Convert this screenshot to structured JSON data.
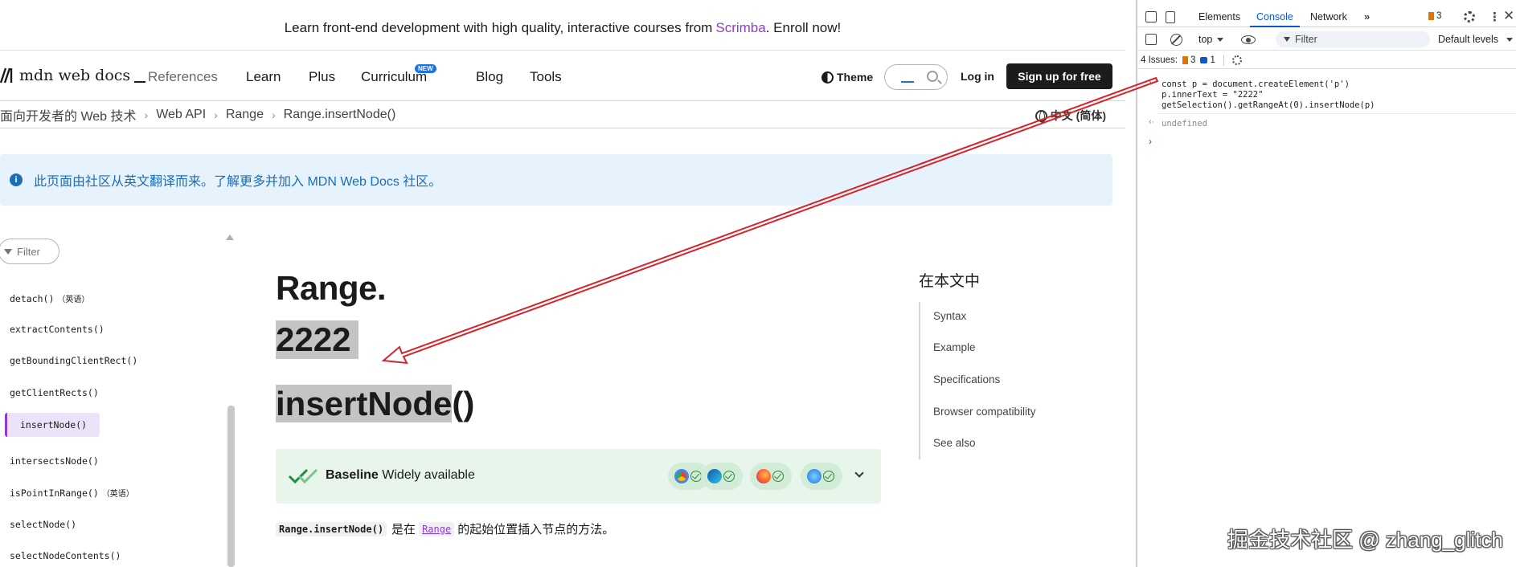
{
  "banner": {
    "prefix": "Learn front-end development with high quality, interactive courses from",
    "link": "Scrimba",
    "suffix": ". Enroll now!"
  },
  "nav": {
    "logo": "mdn web docs",
    "items": [
      "References",
      "Learn",
      "Plus",
      "Curriculum",
      "Blog",
      "Tools"
    ],
    "new_badge": "NEW",
    "theme": "Theme",
    "login": "Log in",
    "signup": "Sign up for free"
  },
  "breadcrumbs": {
    "items": [
      "面向开发者的 Web 技术",
      "Web API",
      "Range",
      "Range.insertNode()"
    ],
    "separator": "›",
    "language": "中文 (简体)"
  },
  "notice": {
    "icon": "i",
    "text": "此页面由社区从英文翻译而来。了解更多并加入 MDN Web Docs 社区。"
  },
  "sidebar": {
    "filter": "Filter",
    "items": [
      {
        "label": "detach()",
        "note": "（英语）"
      },
      {
        "label": "extractContents()",
        "note": ""
      },
      {
        "label": "getBoundingClientRect()",
        "note": ""
      },
      {
        "label": "getClientRects()",
        "note": ""
      },
      {
        "label": "insertNode()",
        "note": "",
        "active": true
      },
      {
        "label": "intersectsNode()",
        "note": ""
      },
      {
        "label": "isPointInRange()",
        "note": "（英语）"
      },
      {
        "label": "selectNode()",
        "note": ""
      },
      {
        "label": "selectNodeContents()",
        "note": ""
      }
    ]
  },
  "article": {
    "title_part1": "Range.",
    "inserted_text": "2222",
    "title_part2_hl": "insertNode",
    "title_part2_rest": "()",
    "baseline_label": "Baseline",
    "baseline_status": "Widely available",
    "desc_code": "Range.insertNode()",
    "desc_mid": "是在",
    "desc_link": "Range",
    "desc_tail": "的起始位置插入节点的方法。"
  },
  "toc": {
    "title": "在本文中",
    "items": [
      "Syntax",
      "Example",
      "Specifications",
      "Browser compatibility",
      "See also"
    ]
  },
  "devtools": {
    "tabs": [
      "Elements",
      "Console",
      "Network"
    ],
    "active_tab": "Console",
    "more": "»",
    "issue_count_badge": "3",
    "context": "top",
    "filter_placeholder": "Filter",
    "levels": "Default levels",
    "issues_label": "4 Issues:",
    "issues_warn": "3",
    "issues_info": "1",
    "console_lines": [
      "const p = document.createElement('p')",
      "p.innerText = \"2222\"",
      "getSelection().getRangeAt(0).insertNode(p)"
    ],
    "result": "undefined"
  },
  "watermark": "掘金技术社区 @ zhang_glitch",
  "colors": {
    "accent_purple": "#8f3bd3",
    "devtools_blue": "#0b57d0",
    "annotation_red": "#d8232a",
    "baseline_green": "#e8f5ea",
    "notice_blue": "#e7f3fc"
  }
}
